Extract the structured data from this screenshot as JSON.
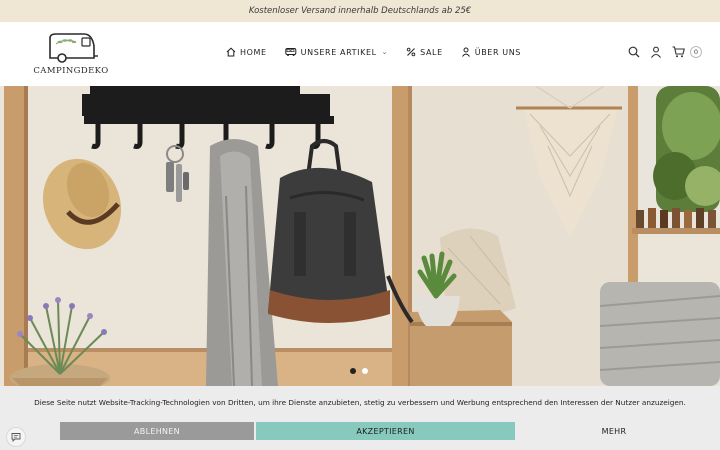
{
  "announcement": {
    "text": "Kostenloser Versand innerhalb Deutschlands ab 25€"
  },
  "brand": {
    "name": "CAMPINGDEKO"
  },
  "nav": {
    "items": [
      {
        "label": "HOME",
        "icon": "home-icon"
      },
      {
        "label": "UNSERE ARTIKEL",
        "icon": "van-icon",
        "has_dropdown": true
      },
      {
        "label": "SALE",
        "icon": "percent-icon"
      },
      {
        "label": "ÜBER UNS",
        "icon": "user-icon"
      }
    ]
  },
  "header_icons": {
    "search": "search-icon",
    "account": "account-icon",
    "cart": "cart-icon",
    "cart_count": "0"
  },
  "hero": {
    "slides_total": 2,
    "active_slide": 1
  },
  "cookie_banner": {
    "text": "Diese Seite nutzt Website-Tracking-Technologien von Dritten, um ihre Dienste anzubieten, stetig zu verbessern und Werbung entsprechend den Interessen der Nutzer anzuzeigen.",
    "decline_label": "ABLEHNEN",
    "accept_label": "AKZEPTIEREN",
    "more_label": "MEHR"
  },
  "chat_widget": {
    "icon": "chat-icon"
  },
  "colors": {
    "announcement_bg": "#efe6d4",
    "accept_button": "#88c9bd",
    "decline_button": "#9a9a9a",
    "cookie_bg": "#ececec"
  }
}
